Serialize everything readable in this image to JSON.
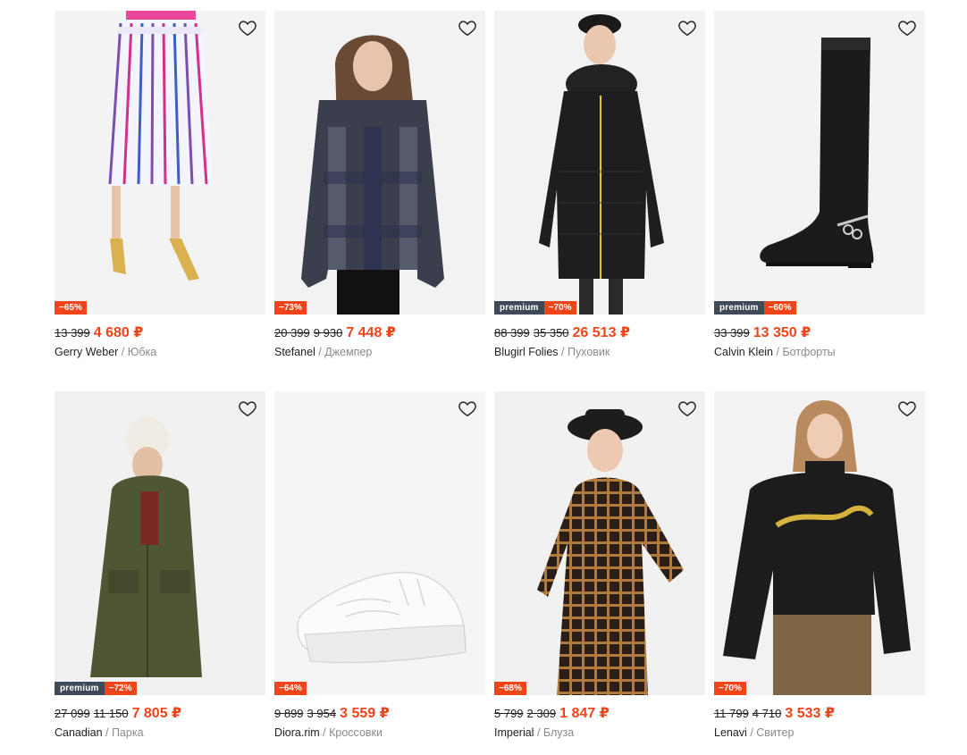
{
  "currency": "₽",
  "products": [
    {
      "brand": "Gerry Weber",
      "sep": " / ",
      "category": "Юбка",
      "old_prices": [
        "13 399"
      ],
      "price": "4 680 ₽",
      "premium": "",
      "discount": "−65%",
      "icon": "heart-icon"
    },
    {
      "brand": "Stefanel",
      "sep": " / ",
      "category": "Джемпер",
      "old_prices": [
        "20 399",
        "9 930"
      ],
      "price": "7 448 ₽",
      "premium": "",
      "discount": "−73%",
      "icon": "heart-icon"
    },
    {
      "brand": "Blugirl Folies",
      "sep": " / ",
      "category": "Пуховик",
      "old_prices": [
        "88 399",
        "35 350"
      ],
      "price": "26 513 ₽",
      "premium": "premium",
      "discount": "−70%",
      "icon": "heart-icon"
    },
    {
      "brand": "Calvin Klein",
      "sep": " / ",
      "category": "Ботфорты",
      "old_prices": [
        "33 399"
      ],
      "price": "13 350 ₽",
      "premium": "premium",
      "discount": "−60%",
      "icon": "heart-icon"
    },
    {
      "brand": "Canadian",
      "sep": " / ",
      "category": "Парка",
      "old_prices": [
        "27 099",
        "11 150"
      ],
      "price": "7 805 ₽",
      "premium": "premium",
      "discount": "−72%",
      "icon": "heart-icon"
    },
    {
      "brand": "Diora.rim",
      "sep": " / ",
      "category": "Кроссовки",
      "old_prices": [
        "9 899",
        "3 954"
      ],
      "price": "3 559 ₽",
      "premium": "",
      "discount": "−64%",
      "icon": "heart-icon"
    },
    {
      "brand": "Imperial",
      "sep": " / ",
      "category": "Блуза",
      "old_prices": [
        "5 799",
        "2 309"
      ],
      "price": "1 847 ₽",
      "premium": "",
      "discount": "−68%",
      "icon": "heart-icon"
    },
    {
      "brand": "Lenavi",
      "sep": " / ",
      "category": "Свитер",
      "old_prices": [
        "11 799",
        "4 710"
      ],
      "price": "3 533 ₽",
      "premium": "",
      "discount": "−70%",
      "icon": "heart-icon"
    }
  ],
  "colors": {
    "accent": "#f0441a",
    "premium_badge": "#3e4a57",
    "muted": "#8a8a8a"
  }
}
